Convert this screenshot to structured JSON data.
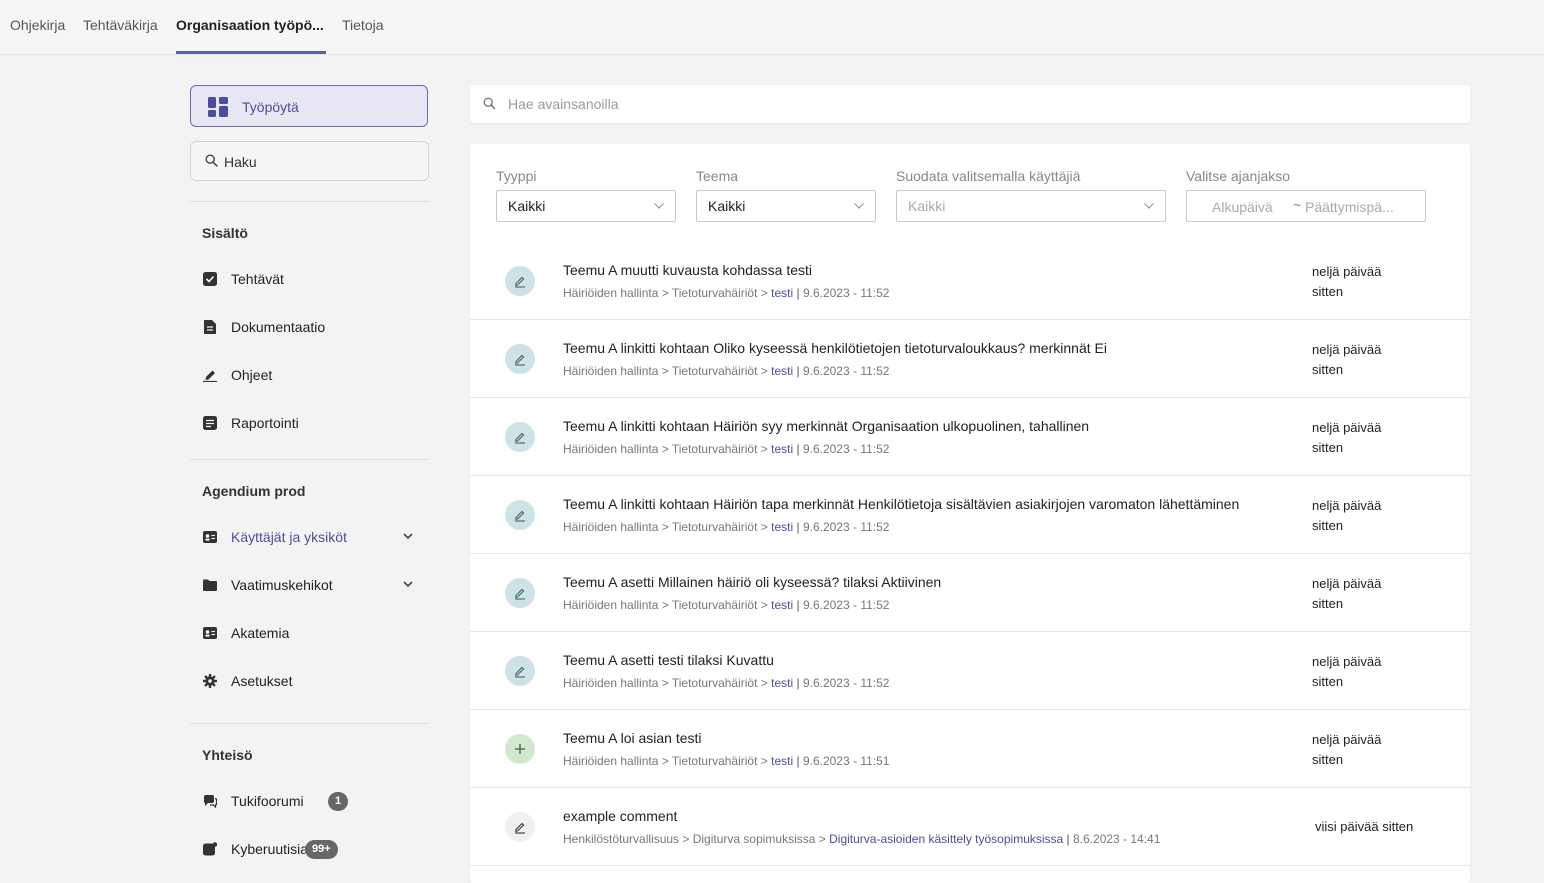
{
  "top_tabs": [
    {
      "label": "Ohjekirja"
    },
    {
      "label": "Tehtäväkirja"
    },
    {
      "label": "Organisaation työpö..."
    },
    {
      "label": "Tietoja"
    }
  ],
  "sidebar": {
    "dashboard_label": "Työpöytä",
    "search_label": "Haku",
    "sections": [
      {
        "title": "Sisältö",
        "items": [
          {
            "label": "Tehtävät",
            "icon": "checkbox-icon"
          },
          {
            "label": "Dokumentaatio",
            "icon": "document-icon"
          },
          {
            "label": "Ohjeet",
            "icon": "pen-icon"
          },
          {
            "label": "Raportointi",
            "icon": "report-icon"
          }
        ]
      },
      {
        "title": "Agendium prod",
        "items": [
          {
            "label": "Käyttäjät ja yksiköt",
            "icon": "contact-card-icon"
          },
          {
            "label": "Vaatimuskehikot",
            "icon": "folder-icon"
          },
          {
            "label": "Akatemia",
            "icon": "id-card-icon"
          },
          {
            "label": "Asetukset",
            "icon": "gear-icon"
          }
        ]
      },
      {
        "title": "Yhteisö",
        "items": [
          {
            "label": "Tukifoorumi",
            "icon": "forum-icon",
            "badge": "1"
          },
          {
            "label": "Kyberuutisia",
            "icon": "news-icon",
            "badge": "99+"
          }
        ]
      }
    ]
  },
  "search": {
    "placeholder": "Hae avainsanoilla"
  },
  "filters": {
    "type": {
      "label": "Tyyppi",
      "value": "Kaikki"
    },
    "theme": {
      "label": "Teema",
      "value": "Kaikki"
    },
    "users": {
      "label": "Suodata valitsemalla käyttäjiä",
      "placeholder": "Kaikki"
    },
    "period": {
      "label": "Valitse ajanjakso",
      "start_placeholder": "Alkupäivä",
      "separator": "~",
      "end_placeholder": "Päättymispä..."
    }
  },
  "colors": {
    "accent": "#4a4e9a",
    "edit_avatar": "#cde3e5",
    "create_avatar": "#d4e8cf"
  },
  "feed": [
    {
      "title": "Teemu A muutti kuvausta kohdassa testi",
      "path": "Häiriöiden hallinta > Tietoturvahäiriöt > ",
      "link": "testi",
      "date": "9.6.2023 - 11:52",
      "time_line1": "neljä päivää",
      "time_line2": "sitten",
      "icon": "edit-icon"
    },
    {
      "title": "Teemu A linkitti kohtaan Oliko kyseessä henkilötietojen tietoturvaloukkaus? merkinnät Ei",
      "path": "Häiriöiden hallinta > Tietoturvahäiriöt > ",
      "link": "testi",
      "date": "9.6.2023 - 11:52",
      "time_line1": "neljä päivää",
      "time_line2": "sitten",
      "icon": "edit-icon"
    },
    {
      "title": "Teemu A linkitti kohtaan Häiriön syy merkinnät Organisaation ulkopuolinen, tahallinen",
      "path": "Häiriöiden hallinta > Tietoturvahäiriöt > ",
      "link": "testi",
      "date": "9.6.2023 - 11:52",
      "time_line1": "neljä päivää",
      "time_line2": "sitten",
      "icon": "edit-icon"
    },
    {
      "title": "Teemu A linkitti kohtaan Häiriön tapa merkinnät Henkilötietoja sisältävien asiakirjojen varomaton lähettäminen",
      "path": "Häiriöiden hallinta > Tietoturvahäiriöt > ",
      "link": "testi",
      "date": "9.6.2023 - 11:52",
      "time_line1": "neljä päivää",
      "time_line2": "sitten",
      "icon": "edit-icon"
    },
    {
      "title": "Teemu A asetti Millainen häiriö oli kyseessä? tilaksi Aktiivinen",
      "path": "Häiriöiden hallinta > Tietoturvahäiriöt > ",
      "link": "testi",
      "date": "9.6.2023 - 11:52",
      "time_line1": "neljä päivää",
      "time_line2": "sitten",
      "icon": "edit-icon"
    },
    {
      "title": "Teemu A asetti testi tilaksi Kuvattu",
      "path": "Häiriöiden hallinta > Tietoturvahäiriöt > ",
      "link": "testi",
      "date": "9.6.2023 - 11:52",
      "time_line1": "neljä päivää",
      "time_line2": "sitten",
      "icon": "edit-icon"
    },
    {
      "title": "Teemu A loi asian testi",
      "path": "Häiriöiden hallinta > Tietoturvahäiriöt > ",
      "link": "testi",
      "date": "9.6.2023 - 11:51",
      "time_line1": "neljä päivää",
      "time_line2": "sitten",
      "icon": "plus-icon"
    },
    {
      "title": "example comment",
      "path": "Henkilöstöturvallisuus > Digiturva sopimuksissa > ",
      "link": "Digiturva-asioiden käsittely työsopimuksissa",
      "date": "8.6.2023 - 14:41",
      "time_line1": "viisi päivää sitten",
      "icon": "comment-edit-icon"
    }
  ]
}
